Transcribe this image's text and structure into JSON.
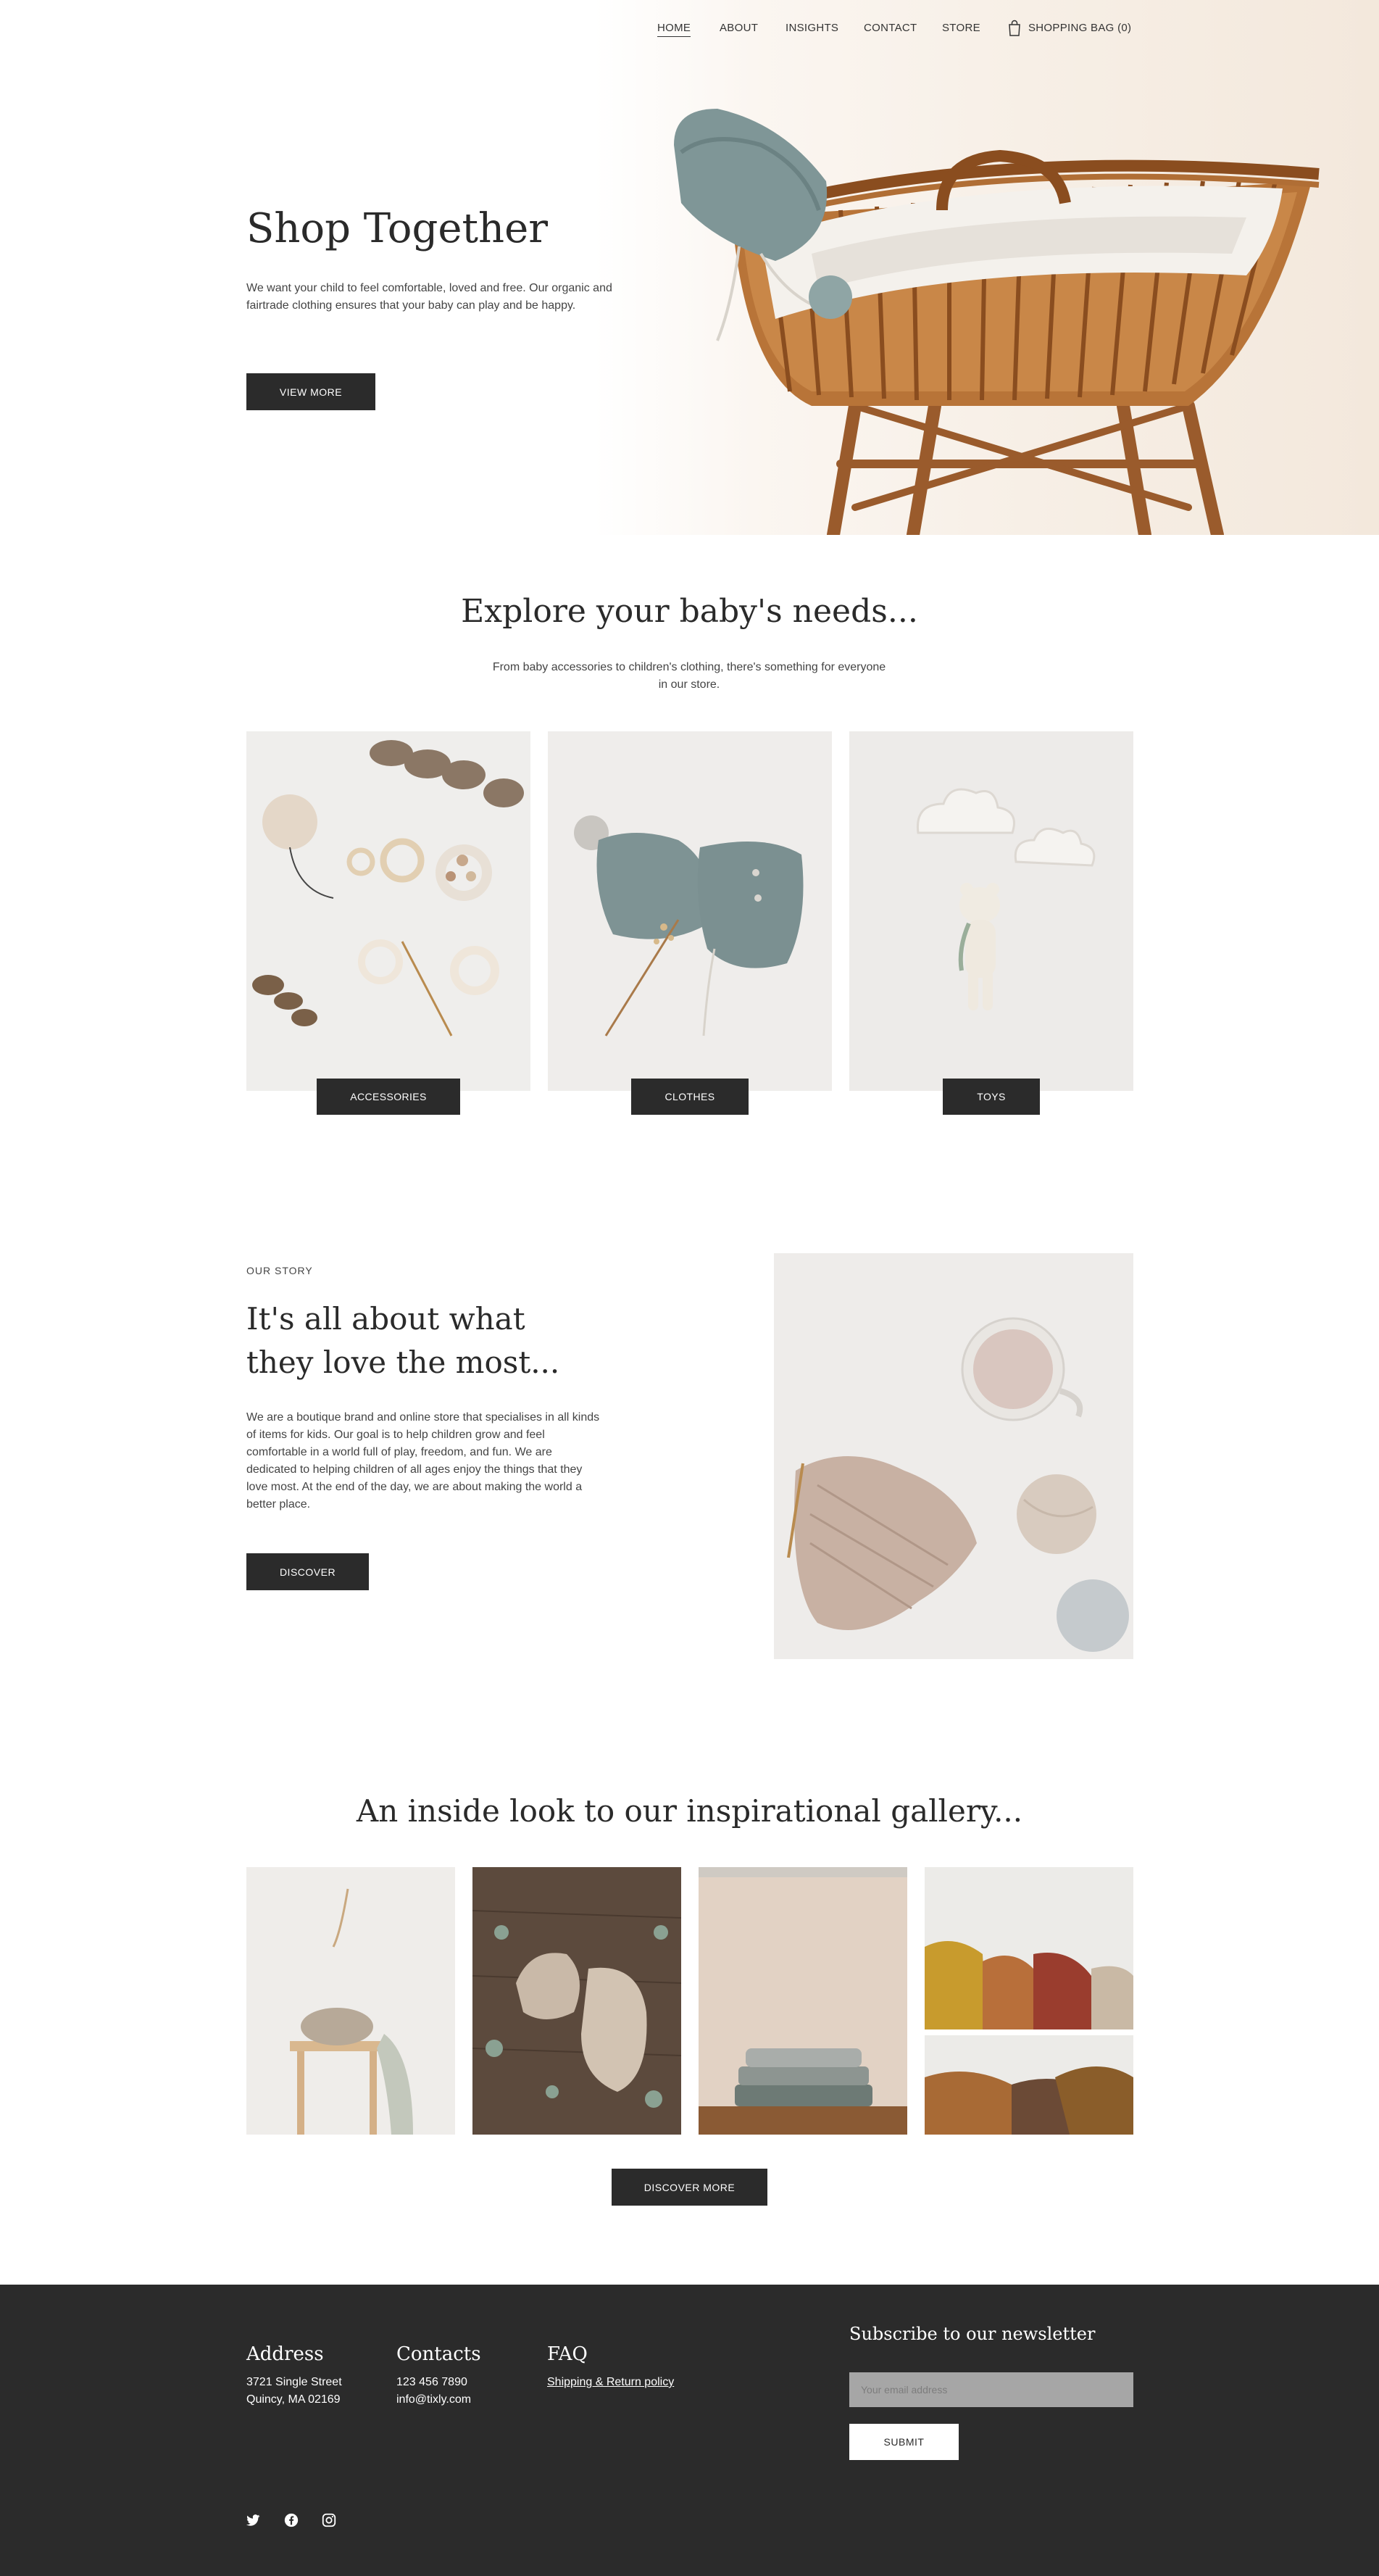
{
  "nav": {
    "items": [
      "HOME",
      "ABOUT",
      "INSIGHTS",
      "CONTACT",
      "STORE"
    ],
    "bag_label": "SHOPPING BAG (0)",
    "bag_icon": "shopping-bag-icon"
  },
  "hero": {
    "title": "Shop Together",
    "text": "We want your child to feel comfortable, loved and free. Our organic and fairtrade clothing ensures that your baby can play and be happy.",
    "button": "VIEW MORE"
  },
  "explore": {
    "title": "Explore your baby's needs...",
    "subtitle": "From baby accessories to children's clothing, there's something for everyone in our store.",
    "categories": [
      "ACCESSORIES",
      "CLOTHES",
      "TOYS"
    ]
  },
  "story": {
    "eyebrow": "OUR STORY",
    "title": "It's all about what they love the most...",
    "text": "We are a boutique brand and online store that specialises in all kinds of items for kids. Our goal is to help children grow and feel comfortable in a world full of play, freedom, and fun. We are dedicated to helping children of all ages enjoy the things that they love most. At the end of the day, we are about making the world a better place.",
    "button": "DISCOVER"
  },
  "gallery": {
    "title": "An inside look to our inspirational gallery...",
    "button": "DISCOVER MORE"
  },
  "footer": {
    "address": {
      "title": "Address",
      "line1": "3721 Single Street",
      "line2": "Quincy, MA 02169"
    },
    "contacts": {
      "title": "Contacts",
      "phone": "123 456 7890",
      "email": "info@tixly.com"
    },
    "faq": {
      "title": "FAQ",
      "link": "Shipping & Return policy"
    },
    "newsletter": {
      "title": "Subscribe to our newsletter",
      "placeholder": "Your email address",
      "button": "SUBMIT"
    },
    "social": [
      "twitter-icon",
      "facebook-icon",
      "instagram-icon"
    ]
  },
  "colors": {
    "dark": "#2b2b2b",
    "background": "#ffffff",
    "input": "#a6a6a6"
  }
}
